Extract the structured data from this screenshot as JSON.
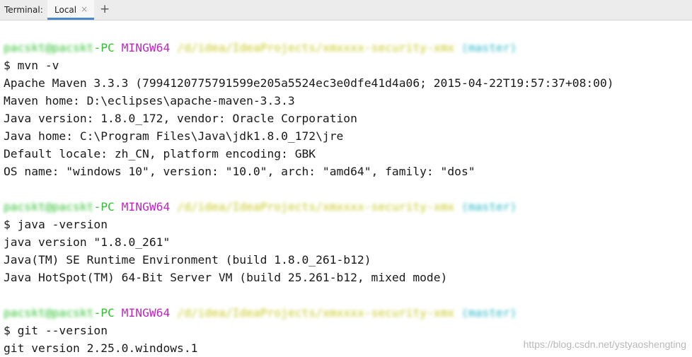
{
  "tabbar": {
    "label": "Terminal:",
    "tab_name": "Local",
    "close_glyph": "×",
    "add_glyph": "+"
  },
  "terminal": {
    "blocks": [
      {
        "prompt": {
          "user": "pacskt@pacskt",
          "pc": "-PC",
          "mingw": "MINGW64",
          "path": "/d/idea/IdeaProjects/xmxxxx-security-xmx",
          "branch": "(master)"
        },
        "command": "$ mvn -v",
        "output": [
          "Apache Maven 3.3.3 (7994120775791599e205a5524ec3e0dfe41d4a06; 2015-04-22T19:57:37+08:00)",
          "Maven home: D:\\eclipses\\apache-maven-3.3.3",
          "Java version: 1.8.0_172, vendor: Oracle Corporation",
          "Java home: C:\\Program Files\\Java\\jdk1.8.0_172\\jre",
          "Default locale: zh_CN, platform encoding: GBK",
          "OS name: \"windows 10\", version: \"10.0\", arch: \"amd64\", family: \"dos\""
        ]
      },
      {
        "prompt": {
          "user": "pacskt@pacskt",
          "pc": "-PC",
          "mingw": "MINGW64",
          "path": "/d/idea/IdeaProjects/xmxxxx-security-xmx",
          "branch": "(master)"
        },
        "command": "$ java -version",
        "output": [
          "java version \"1.8.0_261\"",
          "Java(TM) SE Runtime Environment (build 1.8.0_261-b12)",
          "Java HotSpot(TM) 64-Bit Server VM (build 25.261-b12, mixed mode)"
        ]
      },
      {
        "prompt": {
          "user": "pacskt@pacskt",
          "pc": "-PC",
          "mingw": "MINGW64",
          "path": "/d/idea/IdeaProjects/xmxxxx-security-xmx",
          "branch": "(master)"
        },
        "command": "$ git --version",
        "output": [
          "git version 2.25.0.windows.1"
        ]
      }
    ]
  },
  "watermark": "https://blog.csdn.net/ystyaoshengting"
}
